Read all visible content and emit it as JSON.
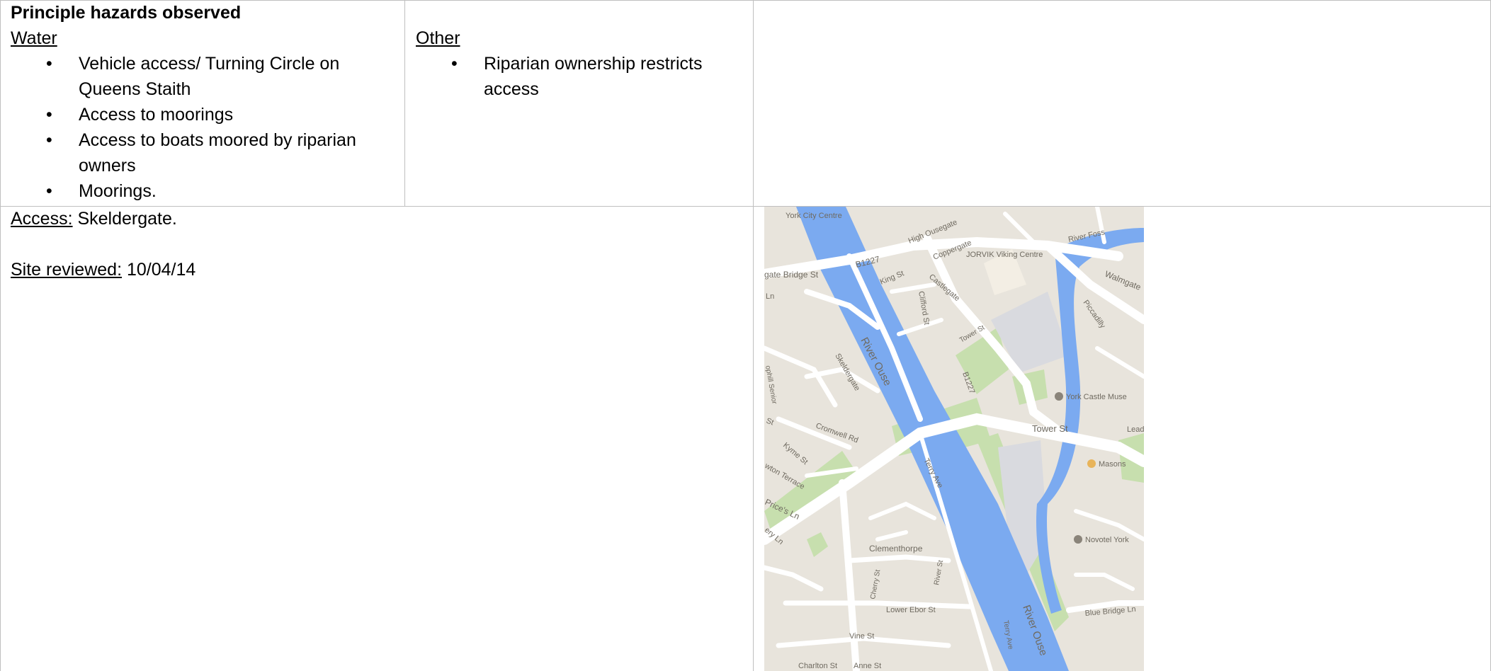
{
  "hazards": {
    "heading": "Principle hazards observed",
    "water": {
      "label": "Water",
      "items": [
        "Vehicle access/ Turning Circle on Queens Staith",
        "Access to moorings",
        "Access to boats moored by riparian owners",
        "Moorings."
      ]
    },
    "other": {
      "label": "Other",
      "items": [
        "Riparian ownership restricts access"
      ]
    }
  },
  "info": {
    "access_label": "Access:",
    "access_value": " Skeldergate.",
    "reviewed_label": "Site reviewed:",
    "reviewed_value": " 10/04/14"
  },
  "map": {
    "labels": {
      "york_city_centre": "York City Centre",
      "high_ousegate": "High Ousegate",
      "coppergate": "Coppergate",
      "jorvik": "JORVIK Viking Centre",
      "river_foss": "River Foss",
      "walmgate": "Walmgate",
      "bridge_st": "gate  Bridge St",
      "b1227_top": "B1227",
      "king_st": "King St",
      "castlegate": "Castlegate",
      "clifford_st": "Clifford St",
      "piccadilly": "Piccadilly",
      "ln": "Ln",
      "tower_st_small": "Tower St",
      "river_ouse": "River Ouse",
      "b1227": "B1227",
      "skeldergate": "Skeldergate",
      "bishophill": "ophill Senior",
      "york_castle": "York Castle Muse",
      "st": "St",
      "cromwell_rd": "Cromwell Rd",
      "tower_st": "Tower St",
      "lead": "Lead",
      "kyme_st": "Kyme St",
      "masons": "Masons",
      "newton_terrace": "wton Terrace",
      "terry_ave": "Terry Ave",
      "prices_ln": "Price's Ln",
      "clementhorpe": "Clementhorpe",
      "novotel": "Novotel York",
      "lery_ln": "ery Ln",
      "cherry_st": "Cherry St",
      "river_st": "River St",
      "lower_ebor_st": "Lower Ebor St",
      "blue_bridge_ln": "Blue Bridge Ln",
      "river_ouse_bottom": "River Ouse",
      "terry_ave_bottom": "Terry Ave",
      "vine_st": "Vine St",
      "charlton_st": "Charlton St",
      "anne_st": "Anne St"
    },
    "colors": {
      "land": "#e8e4dc",
      "water": "#7baaf0",
      "park": "#c7dfae",
      "road": "#ffffff",
      "building": "#d9dadf"
    }
  }
}
